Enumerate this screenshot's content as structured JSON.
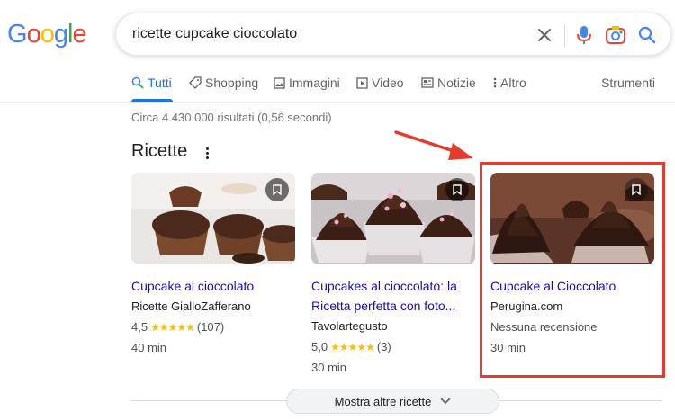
{
  "logo": {
    "letters": [
      "G",
      "o",
      "o",
      "g",
      "l",
      "e"
    ],
    "colors": [
      "#4285f4",
      "#ea4335",
      "#fbbc05",
      "#4285f4",
      "#34a853",
      "#ea4335"
    ]
  },
  "search": {
    "query": "ricette cupcake cioccolato"
  },
  "tabs": [
    {
      "label": "Tutti",
      "icon": "search-icon"
    },
    {
      "label": "Shopping",
      "icon": "tag-icon"
    },
    {
      "label": "Immagini",
      "icon": "image-icon"
    },
    {
      "label": "Video",
      "icon": "play-icon"
    },
    {
      "label": "Notizie",
      "icon": "news-icon"
    },
    {
      "label": "Altro",
      "icon": "more-vert-icon"
    }
  ],
  "tools_label": "Strumenti",
  "stats": "Circa 4.430.000 risultati (0,56 secondi)",
  "section_title": "Ricette",
  "recipes": [
    {
      "title": "Cupcake al cioccolato",
      "source": "Ricette GialloZafferano",
      "rating_value": "4,5",
      "stars": "★★★★★",
      "rating_count": "(107)",
      "time": "40 min"
    },
    {
      "title": "Cupcakes al cioccolato: la Ricetta perfetta con foto...",
      "source": "Tavolartegusto",
      "rating_value": "5,0",
      "stars": "★★★★★",
      "rating_count": "(3)",
      "time": "30 min"
    },
    {
      "title": "Cupcake al Cioccolato",
      "source": "Perugina.com",
      "no_review": "Nessuna recensione",
      "time": "30 min"
    }
  ],
  "show_more_label": "Mostra altre ricette",
  "colors": {
    "link": "#1a0dab",
    "accent": "#1a73e8",
    "highlight": "#e53b2c",
    "star": "#fbbc04"
  }
}
